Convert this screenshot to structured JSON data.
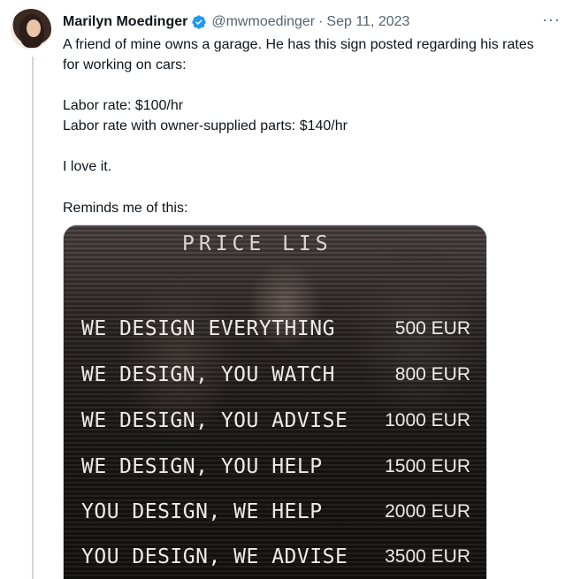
{
  "tweet": {
    "author_name": "Marilyn Moedinger",
    "handle": "@mwmoedinger",
    "separator": "·",
    "date": "Sep 11, 2023",
    "more_icon": "more-dots-icon",
    "verified_icon": "verified-badge-icon",
    "lines": [
      "A friend of mine owns a garage. He has this sign posted regarding his rates",
      "for working on cars:",
      "Labor rate: $100/hr",
      "Labor rate with owner-supplied parts: $140/hr",
      "I love it.",
      "Reminds me of this:"
    ]
  },
  "sign": {
    "title": "PRICE LIS",
    "rows": [
      {
        "service": "WE DESIGN EVERYTHING",
        "price": "500 EUR"
      },
      {
        "service": "WE DESIGN, YOU WATCH",
        "price": "800 EUR"
      },
      {
        "service": "WE DESIGN, YOU ADVISE",
        "price": "1000 EUR"
      },
      {
        "service": "WE DESIGN, YOU HELP",
        "price": "1500 EUR"
      },
      {
        "service": "YOU DESIGN, WE HELP",
        "price": "2000 EUR"
      },
      {
        "service": "YOU DESIGN, WE ADVISE",
        "price": "3500 EUR"
      }
    ]
  },
  "colors": {
    "verified": "#1d9bf0",
    "secondary_text": "#536471",
    "thread_line": "#cfd9de"
  }
}
